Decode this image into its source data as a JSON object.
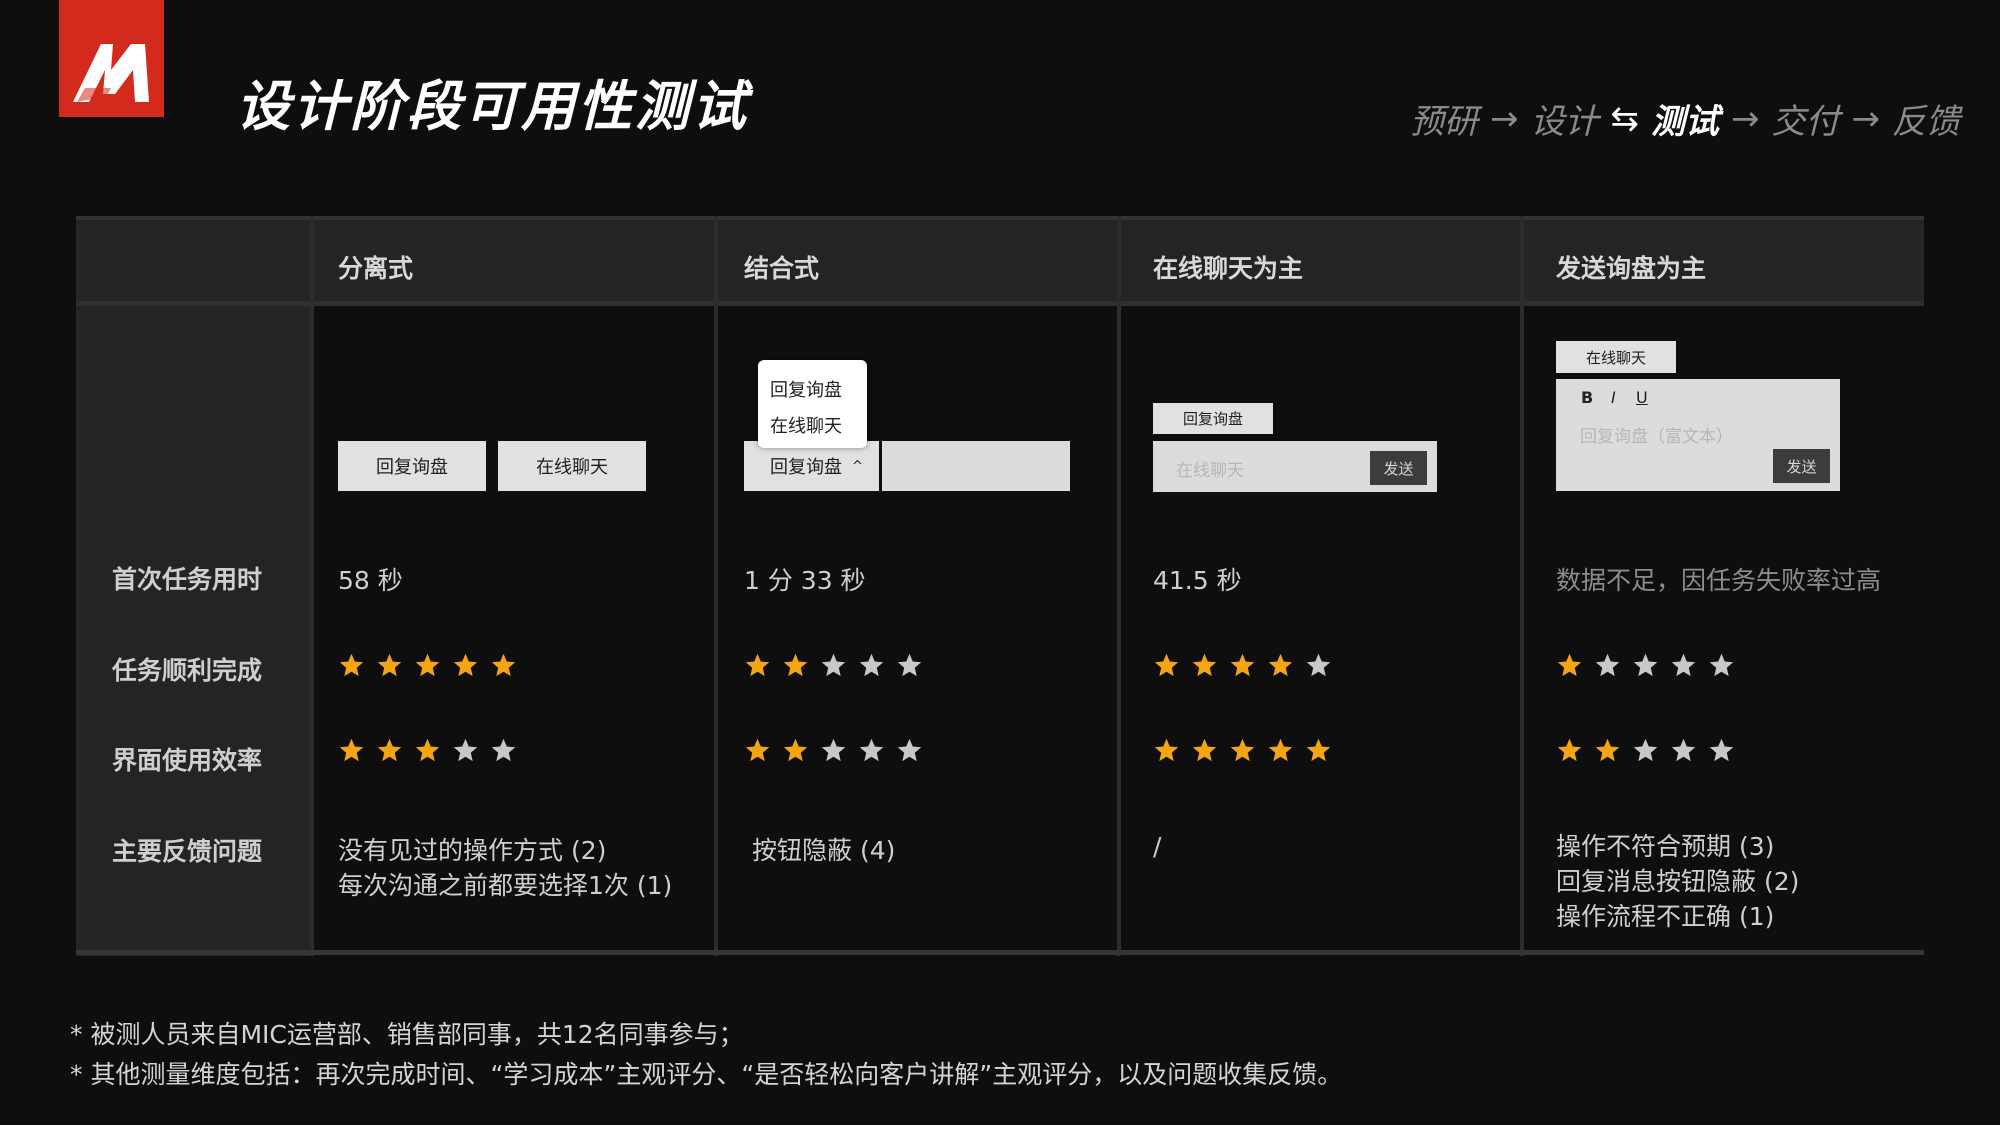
{
  "header": {
    "title": "设计阶段可用性测试",
    "process": [
      {
        "label": "预研",
        "active": false
      },
      {
        "label": "设计",
        "active": false
      },
      {
        "label": "测试",
        "active": true
      },
      {
        "label": "交付",
        "active": false
      },
      {
        "label": "反馈",
        "active": false
      }
    ]
  },
  "table": {
    "columns": [
      "分离式",
      "结合式",
      "在线聊天为主",
      "发送询盘为主"
    ],
    "row_labels": [
      "首次任务用时",
      "任务顺利完成",
      "界面使用效率",
      "主要反馈问题"
    ],
    "task_time": [
      "58 秒",
      "1 分 33 秒",
      "41.5 秒",
      "数据不足，因任务失败率过高"
    ],
    "completion_stars": [
      5,
      2,
      4,
      1
    ],
    "efficiency_stars": [
      3,
      2,
      5,
      2
    ],
    "star_max": 5,
    "feedback": [
      [
        "没有见过的操作方式 (2)",
        "每次沟通之前都要选择1次 (1)"
      ],
      [
        "按钮隐蔽 (4)"
      ],
      [
        "/"
      ],
      [
        "操作不符合预期 (3)",
        "回复消息按钮隐蔽 (2)",
        "操作流程不正确 (1)"
      ]
    ]
  },
  "mockups": {
    "separate": {
      "reply": "回复询盘",
      "chat": "在线聊天"
    },
    "combined": {
      "popup_items": [
        "回复询盘",
        "在线聊天"
      ],
      "button": "回复询盘",
      "caret": "^"
    },
    "chat_first": {
      "tag": "回复询盘",
      "placeholder": "在线聊天",
      "send": "发送"
    },
    "inquiry_first": {
      "tag": "在线聊天",
      "bold": "B",
      "italic": "I",
      "underline": "U",
      "placeholder": "回复询盘（富文本）",
      "send": "发送"
    }
  },
  "footnotes": [
    "* 被测人员来自MIC运营部、销售部同事，共12名同事参与；",
    "* 其他测量维度包括：再次完成时间、“学习成本”主观评分、“是否轻松向客户讲解”主观评分，以及问题收集反馈。"
  ],
  "colors": {
    "accent": "#d32a1e",
    "star_on": "#f4a514",
    "star_off": "#c8c8c8",
    "background": "#0e0e0e"
  }
}
